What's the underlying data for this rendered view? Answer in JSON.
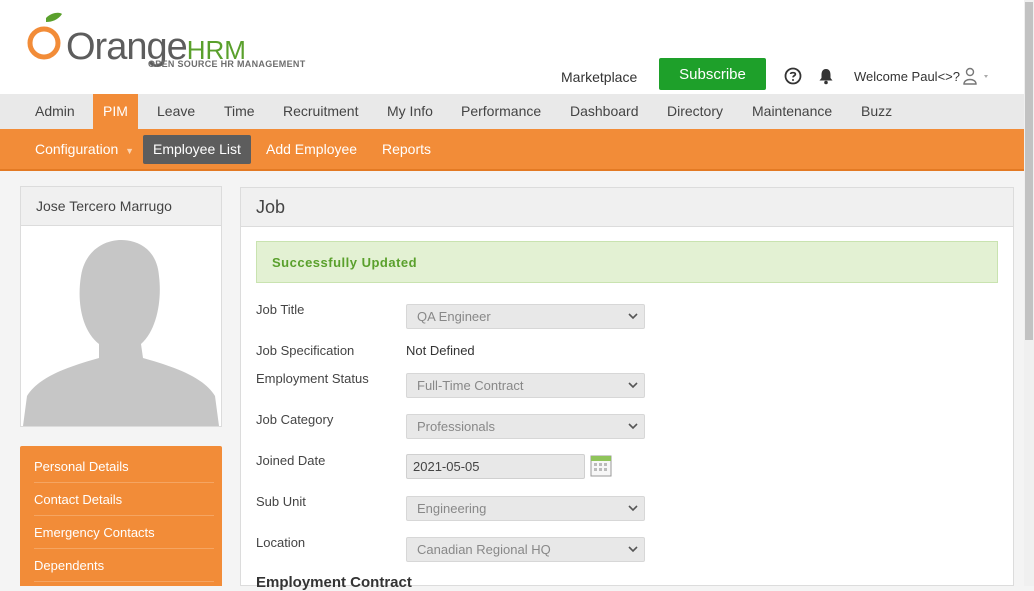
{
  "brand": {
    "name_part1": "Orange",
    "name_part2": "HRM",
    "tagline": "OPEN SOURCE HR MANAGEMENT",
    "orange": "#f28c38",
    "green": "#5aa02c"
  },
  "header": {
    "marketplace": "Marketplace",
    "subscribe": "Subscribe",
    "welcome": "Welcome Paul<>?",
    "help_icon": "help-icon",
    "bell_icon": "bell-icon",
    "user_icon": "user-icon"
  },
  "topnav": [
    "Admin",
    "PIM",
    "Leave",
    "Time",
    "Recruitment",
    "My Info",
    "Performance",
    "Dashboard",
    "Directory",
    "Maintenance",
    "Buzz"
  ],
  "topnav_active": "PIM",
  "subnav": {
    "configuration": "Configuration",
    "employee_list": "Employee List",
    "add_employee": "Add Employee",
    "reports": "Reports"
  },
  "employee": {
    "name": "Jose Tercero Marrugo"
  },
  "side_menu": [
    "Personal Details",
    "Contact Details",
    "Emergency Contacts",
    "Dependents"
  ],
  "job": {
    "title": "Job",
    "message": "Successfully Updated",
    "fields": {
      "job_title": {
        "label": "Job Title",
        "value": "QA Engineer"
      },
      "job_spec": {
        "label": "Job Specification",
        "value": "Not Defined"
      },
      "employment_status": {
        "label": "Employment Status",
        "value": "Full-Time Contract"
      },
      "job_category": {
        "label": "Job Category",
        "value": "Professionals"
      },
      "joined_date": {
        "label": "Joined Date",
        "value": "2021-05-05"
      },
      "sub_unit": {
        "label": "Sub Unit",
        "value": "Engineering"
      },
      "location": {
        "label": "Location",
        "value": "Canadian Regional HQ"
      }
    },
    "section_contract": "Employment Contract"
  }
}
